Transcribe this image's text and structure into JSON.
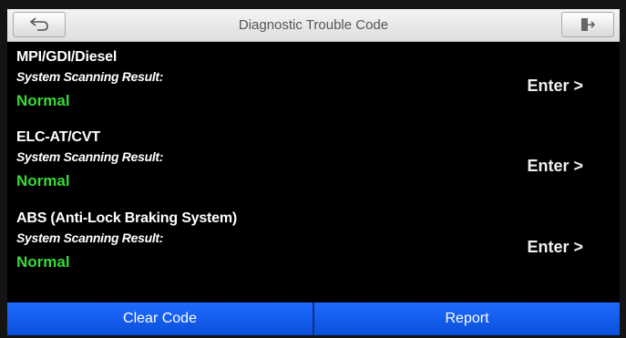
{
  "header": {
    "title": "Diagnostic Trouble Code"
  },
  "systems": [
    {
      "name": "MPI/GDI/Diesel",
      "label": "System Scanning Result:",
      "status": "Normal",
      "action": "Enter >"
    },
    {
      "name": "ELC-AT/CVT",
      "label": "System Scanning Result:",
      "status": "Normal",
      "action": "Enter >"
    },
    {
      "name": "ABS (Anti-Lock Braking System)",
      "label": "System Scanning Result:",
      "status": "Normal",
      "action": "Enter >"
    }
  ],
  "footer": {
    "clear_label": "Clear Code",
    "report_label": "Report"
  },
  "colors": {
    "status_normal": "#3ad63a",
    "button_blue": "#1f6bff"
  },
  "icons": {
    "back": "back-arrow-icon",
    "exit": "exit-door-icon"
  }
}
